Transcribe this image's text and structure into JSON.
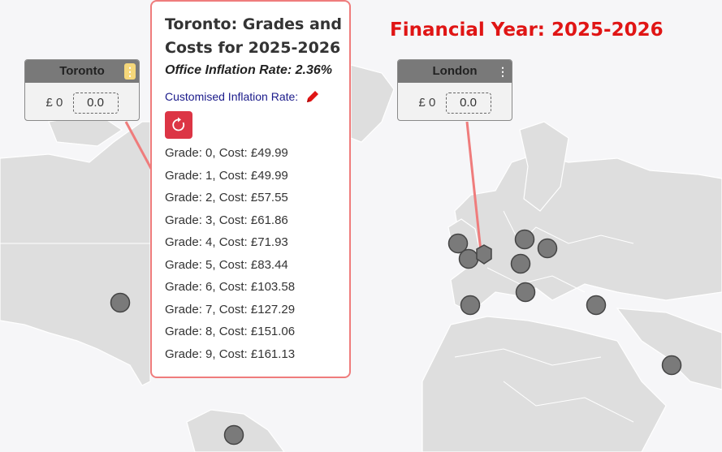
{
  "header": {
    "financial_year": "Financial Year: 2025-2026"
  },
  "offices": [
    {
      "name": "Toronto",
      "currency": "£ 0",
      "value": "0.0"
    },
    {
      "name": "London",
      "currency": "£ 0",
      "value": "0.0"
    }
  ],
  "popup": {
    "title": "Toronto: Grades and Costs for 2025-2026",
    "office_inflation": "Office Inflation Rate: 2.36%",
    "custom_inflation_label": "Customised Inflation Rate:",
    "grades": [
      "Grade: 0, Cost: £49.99",
      "Grade: 1, Cost: £49.99",
      "Grade: 2, Cost: £57.55",
      "Grade: 3, Cost: £61.86",
      "Grade: 4, Cost: £71.93",
      "Grade: 5, Cost: £83.44",
      "Grade: 6, Cost: £103.58",
      "Grade: 7, Cost: £127.29",
      "Grade: 8, Cost: £151.06",
      "Grade: 9, Cost: £161.13"
    ]
  },
  "colors": {
    "accent": "#e01515",
    "popup_border": "#ef7c7c",
    "reset_button": "#dc3545",
    "marker": "#7a7a7a"
  }
}
